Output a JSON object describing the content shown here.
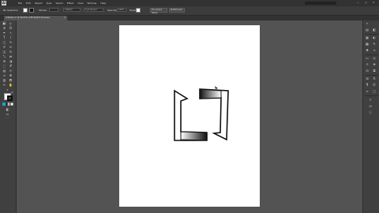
{
  "app": {
    "logo": "Ai"
  },
  "menu": {
    "items": [
      "File",
      "Edit",
      "Object",
      "Type",
      "Select",
      "Effect",
      "View",
      "Window",
      "Help"
    ]
  },
  "window": {
    "minimize": "—",
    "maximize": "□",
    "close": "✕"
  },
  "control_bar": {
    "selection_label": "No Selection",
    "stroke_label": "Stroke:",
    "stroke_profile": "Uniform",
    "brush": "5 pt. Round",
    "opacity_label": "Opacity:",
    "opacity_value": "100%",
    "style_label": "Style:",
    "doc_setup": "Document Setup",
    "preferences": "Preferences"
  },
  "document_tab": {
    "title": "Untitled-1* @ 56.05% (CMYK/GPU Preview)",
    "close": "×"
  },
  "tools": {
    "selection": "▶",
    "direct_selection": "▷",
    "magic_wand": "✲",
    "lasso": "ʘ",
    "pen": "✒",
    "curvature": "∿",
    "type": "T",
    "line": "/",
    "rectangle": "□",
    "paintbrush": "✎",
    "shaper": "✐",
    "pencil": "✏",
    "eraser": "◫",
    "rotate": "↻",
    "scale": "⤡",
    "width": "⋈",
    "free_transform": "⊞",
    "shape_builder": "◑",
    "perspective": "⬚",
    "mesh": "#",
    "gradient": "▤",
    "eyedropper": "✍",
    "blend": "∞",
    "symbol_sprayer": "❋",
    "graph": "▥",
    "artboard": "⬒",
    "slice": "✂",
    "hand": "✋",
    "zoom": "⌕",
    "swap": "⇄",
    "draw_mode": "◧",
    "screen_mode": "▭",
    "more": "···"
  },
  "colors": {
    "canvas_bg": "#535353",
    "panel_bg": "#404040",
    "artboard": "#ffffff",
    "gradient_dark": "#111111",
    "gradient_light": "#ffffff"
  }
}
